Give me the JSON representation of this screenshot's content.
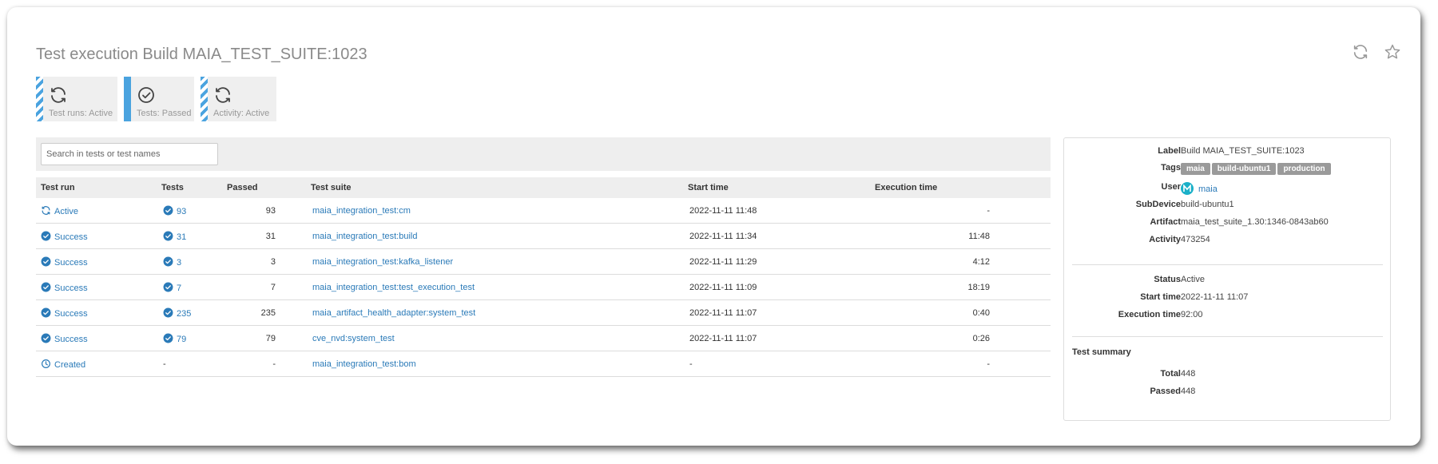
{
  "page": {
    "title": "Test execution Build MAIA_TEST_SUITE:1023"
  },
  "header_icons": [
    "refresh-icon",
    "star-icon"
  ],
  "status_tiles": [
    {
      "label": "Test runs: Active",
      "icon": "refresh-icon",
      "style": "striped"
    },
    {
      "label": "Tests: Passed",
      "icon": "check-circle-icon",
      "style": "solid"
    },
    {
      "label": "Activity: Active",
      "icon": "refresh-icon",
      "style": "striped"
    }
  ],
  "search": {
    "placeholder": "Search in tests or test names"
  },
  "table": {
    "headers": [
      "Test run",
      "Tests",
      "Passed",
      "Test suite",
      "Start time",
      "Execution time"
    ],
    "rows": [
      {
        "status": "Active",
        "status_icon": "refresh-icon",
        "tests": "93",
        "passed": "93",
        "suite": "maia_integration_test:cm",
        "start": "2022-11-11 11:48",
        "exec": "-"
      },
      {
        "status": "Success",
        "status_icon": "check-circle-icon",
        "tests": "31",
        "passed": "31",
        "suite": "maia_integration_test:build",
        "start": "2022-11-11 11:34",
        "exec": "11:48"
      },
      {
        "status": "Success",
        "status_icon": "check-circle-icon",
        "tests": "3",
        "passed": "3",
        "suite": "maia_integration_test:kafka_listener",
        "start": "2022-11-11 11:29",
        "exec": "4:12"
      },
      {
        "status": "Success",
        "status_icon": "check-circle-icon",
        "tests": "7",
        "passed": "7",
        "suite": "maia_integration_test:test_execution_test",
        "start": "2022-11-11 11:09",
        "exec": "18:19"
      },
      {
        "status": "Success",
        "status_icon": "check-circle-icon",
        "tests": "235",
        "passed": "235",
        "suite": "maia_artifact_health_adapter:system_test",
        "start": "2022-11-11 11:07",
        "exec": "0:40"
      },
      {
        "status": "Success",
        "status_icon": "check-circle-icon",
        "tests": "79",
        "passed": "79",
        "suite": "cve_nvd:system_test",
        "start": "2022-11-11 11:07",
        "exec": "0:26"
      },
      {
        "status": "Created",
        "status_icon": "clock-icon",
        "tests": "-",
        "passed": "-",
        "suite": "maia_integration_test:bom",
        "start": "-",
        "exec": "-"
      }
    ]
  },
  "info": {
    "label": {
      "key": "Label",
      "value": "Build MAIA_TEST_SUITE:1023"
    },
    "tags": {
      "key": "Tags",
      "values": [
        "maia",
        "build-ubuntu1",
        "production"
      ]
    },
    "user": {
      "key": "User",
      "value": "maia"
    },
    "subdevice": {
      "key": "SubDevice",
      "value": "build-ubuntu1"
    },
    "artifact": {
      "key": "Artifact",
      "value": "maia_test_suite_1.30:1346-0843ab60"
    },
    "activity": {
      "key": "Activity",
      "value": "473254"
    },
    "status": {
      "key": "Status",
      "value": "Active"
    },
    "start_time": {
      "key": "Start time",
      "value": "2022-11-11 11:07"
    },
    "execution_time": {
      "key": "Execution time",
      "value": "92:00"
    },
    "summary_title": "Test summary",
    "total": {
      "key": "Total",
      "value": "448"
    },
    "passed": {
      "key": "Passed",
      "value": "448"
    }
  },
  "colors": {
    "accent": "#4aa3df",
    "link": "#2a7ab8",
    "tag_bg": "#9a9a9a",
    "avatar": "#1ab0c8"
  }
}
